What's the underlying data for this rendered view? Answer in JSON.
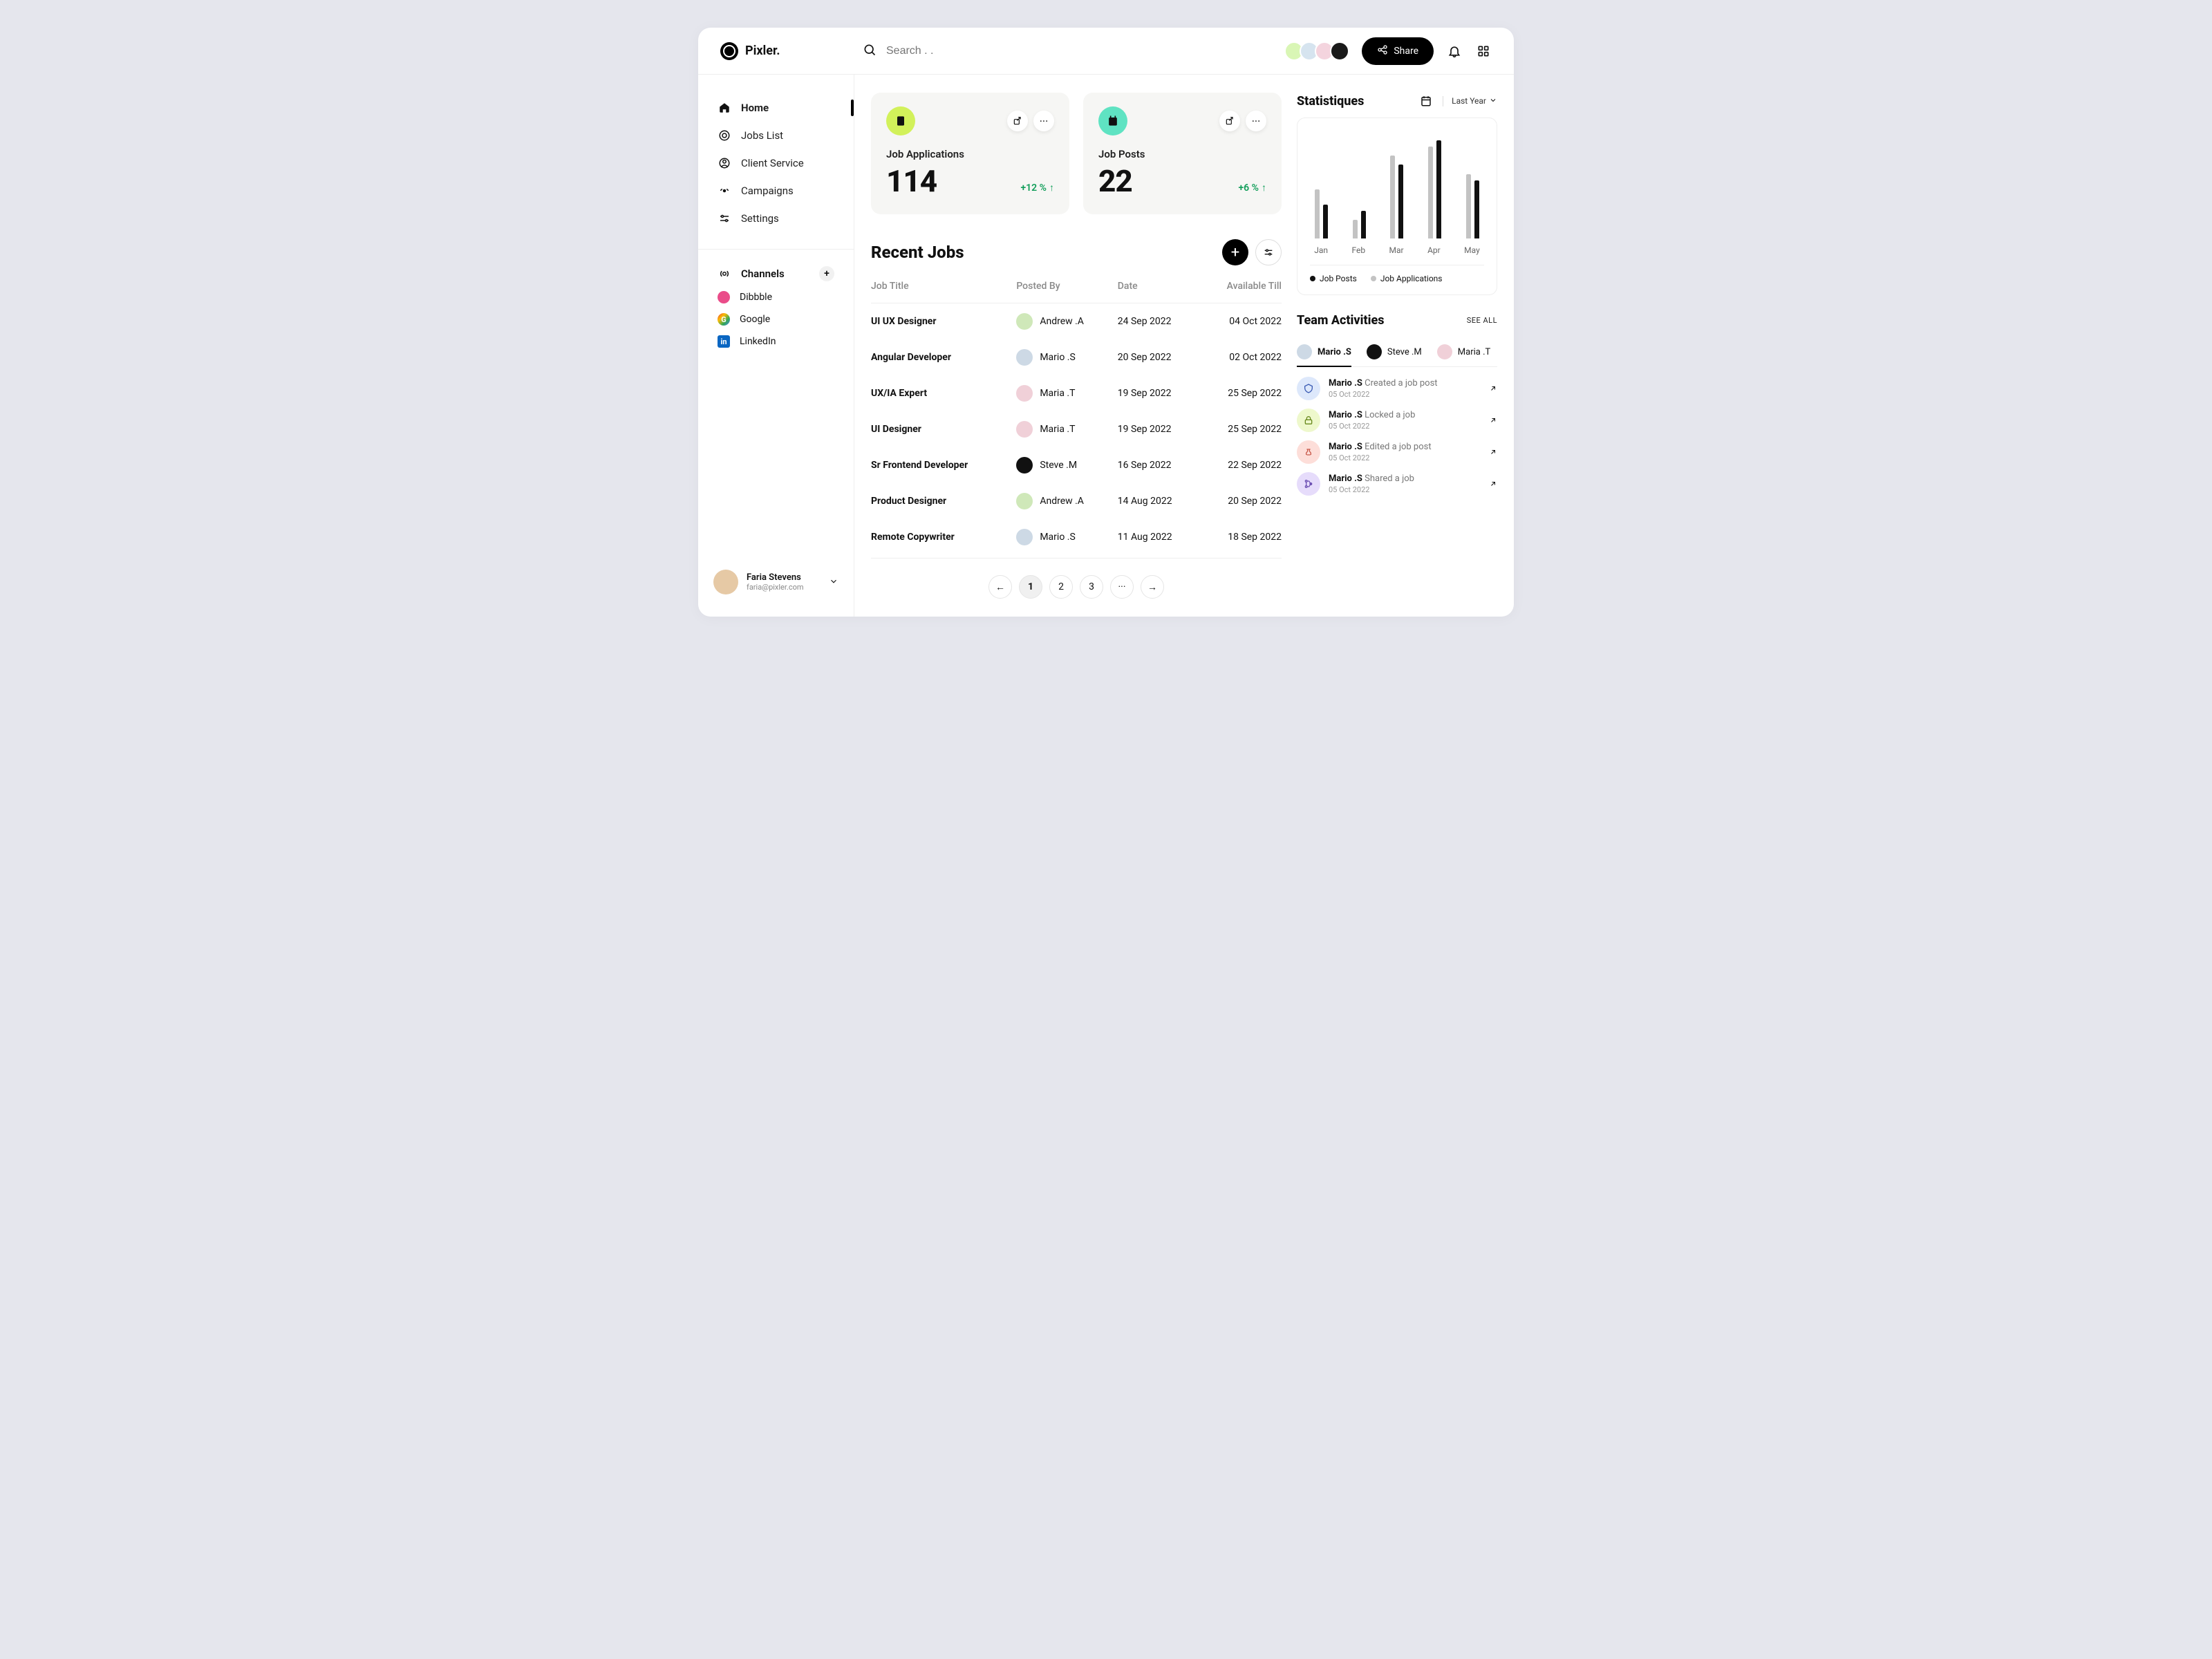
{
  "brand": "Pixler.",
  "search": {
    "placeholder": "Search . ."
  },
  "share_label": "Share",
  "sidebar": {
    "nav": [
      {
        "label": "Home"
      },
      {
        "label": "Jobs List"
      },
      {
        "label": "Client Service"
      },
      {
        "label": "Campaigns"
      },
      {
        "label": "Settings"
      }
    ],
    "channels_label": "Channels",
    "channels": [
      {
        "label": "Dibbble"
      },
      {
        "label": "Google"
      },
      {
        "label": "LinkedIn"
      }
    ],
    "user": {
      "name": "Faria Stevens",
      "email": "faria@pixler.com"
    }
  },
  "cards": [
    {
      "label": "Job Applications",
      "value": "114",
      "delta": "+12 %"
    },
    {
      "label": "Job Posts",
      "value": "22",
      "delta": "+6 %"
    }
  ],
  "recent": {
    "title": "Recent Jobs",
    "columns": {
      "c1": "Job Title",
      "c2": "Posted By",
      "c3": "Date",
      "c4": "Available Till"
    },
    "rows": [
      {
        "title": "UI UX Designer",
        "poster": "Andrew .A",
        "date": "24 Sep 2022",
        "till": "04 Oct 2022",
        "av": "pv-a"
      },
      {
        "title": "Angular Developer",
        "poster": "Mario .S",
        "date": "20 Sep 2022",
        "till": "02 Oct 2022",
        "av": "pv-b"
      },
      {
        "title": "UX/IA Expert",
        "poster": "Maria .T",
        "date": "19 Sep 2022",
        "till": "25 Sep 2022",
        "av": "pv-c"
      },
      {
        "title": "UI Designer",
        "poster": "Maria .T",
        "date": "19 Sep 2022",
        "till": "25 Sep 2022",
        "av": "pv-c"
      },
      {
        "title": "Sr Frontend Developer",
        "poster": "Steve .M",
        "date": "16 Sep 2022",
        "till": "22 Sep 2022",
        "av": "pv-d"
      },
      {
        "title": "Product Designer",
        "poster": "Andrew .A",
        "date": "14 Aug 2022",
        "till": "20 Sep 2022",
        "av": "pv-a"
      },
      {
        "title": "Remote Copywriter",
        "poster": "Mario .S",
        "date": "11 Aug 2022",
        "till": "18 Sep 2022",
        "av": "pv-b"
      }
    ],
    "pagination": {
      "pages": [
        "1",
        "2",
        "3"
      ],
      "ellipsis": "···"
    }
  },
  "stats": {
    "title": "Statistiques",
    "range": "Last Year",
    "legend": {
      "a": "Job Posts",
      "b": "Job Applications"
    }
  },
  "chart_data": {
    "type": "bar",
    "categories": [
      "Jan",
      "Feb",
      "Mar",
      "Apr",
      "May"
    ],
    "series": [
      {
        "name": "Job Posts",
        "values": [
          80,
          30,
          135,
          150,
          105
        ]
      },
      {
        "name": "Job Applications",
        "values": [
          55,
          45,
          120,
          160,
          95
        ]
      }
    ],
    "ylim": [
      0,
      180
    ]
  },
  "team": {
    "title": "Team Activities",
    "see_all": "SEE ALL",
    "tabs": [
      {
        "label": "Mario .S"
      },
      {
        "label": "Steve .M"
      },
      {
        "label": "Maria .T"
      }
    ],
    "activities": [
      {
        "user": "Mario .S",
        "action": "Created a job post",
        "date": "05 Oct 2022",
        "ic": "ic-b"
      },
      {
        "user": "Mario .S",
        "action": "Locked a job",
        "date": "05 Oct 2022",
        "ic": "ic-g"
      },
      {
        "user": "Mario .S",
        "action": "Edited a job post",
        "date": "05 Oct 2022",
        "ic": "ic-p"
      },
      {
        "user": "Mario .S",
        "action": "Shared a job",
        "date": "05 Oct 2022",
        "ic": "ic-v"
      }
    ]
  }
}
